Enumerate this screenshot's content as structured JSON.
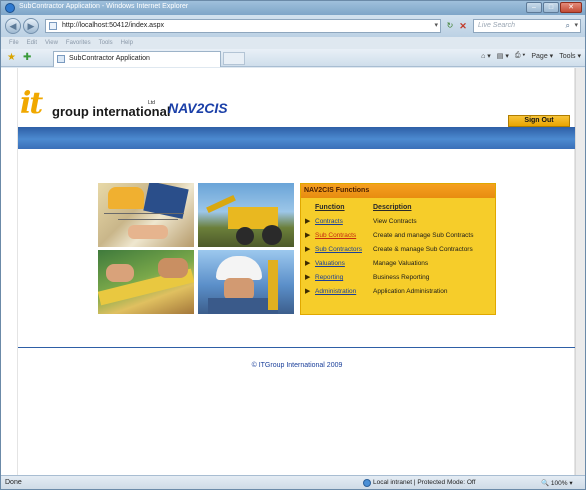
{
  "window": {
    "title": "SubContractor Application - Windows Internet Explorer",
    "url": "http://localhost:50412/index.aspx",
    "search_placeholder": "Live Search",
    "menu": [
      "File",
      "Edit",
      "View",
      "Favorites",
      "Tools",
      "Help"
    ],
    "tab_label": "SubContractor Application",
    "tools": {
      "page": "Page ▾",
      "tools": "Tools ▾"
    }
  },
  "header": {
    "logo_it": "it",
    "logo_group": "group international",
    "logo_ltd": "Ltd",
    "logo_nav": "NAV2CIS",
    "sign_out": "Sign Out"
  },
  "functions": {
    "title": "NAV2CIS Functions",
    "col_function": "Function",
    "col_description": "Description",
    "rows": [
      {
        "name": "Contracts",
        "desc": "View Contracts",
        "active": false
      },
      {
        "name": "Sub Contracts",
        "desc": "Create and manage Sub Contracts",
        "active": true
      },
      {
        "name": "Sub Contractors",
        "desc": "Create & manage Sub Contractors",
        "active": false
      },
      {
        "name": "Valuations",
        "desc": "Manage Valuations",
        "active": false
      },
      {
        "name": "Reporting",
        "desc": "Business Reporting",
        "active": false
      },
      {
        "name": "Administration",
        "desc": "Application Administration",
        "active": false
      }
    ]
  },
  "footer": {
    "copyright": "© ITGroup International 2009"
  },
  "status": {
    "left": "Done",
    "zone": "Local intranet | Protected Mode: Off",
    "zoom": "100%"
  },
  "colors": {
    "brand_yellow": "#f6cd2a",
    "brand_orange": "#e88c10",
    "brand_blue": "#2e5fa6"
  }
}
